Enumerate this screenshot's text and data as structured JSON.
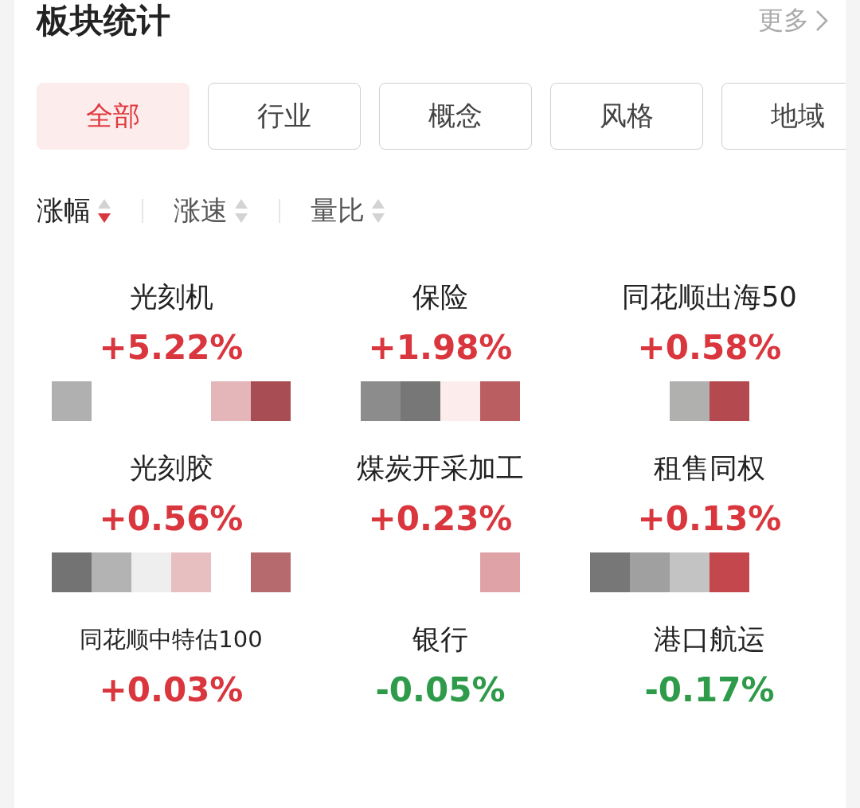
{
  "header": {
    "title": "板块统计",
    "more": "更多"
  },
  "tabs": [
    {
      "label": "全部",
      "selected": true
    },
    {
      "label": "行业",
      "selected": false
    },
    {
      "label": "概念",
      "selected": false
    },
    {
      "label": "风格",
      "selected": false
    },
    {
      "label": "地域",
      "selected": false
    }
  ],
  "sort_options": [
    {
      "label": "涨幅",
      "selected": true
    },
    {
      "label": "涨速",
      "selected": false
    },
    {
      "label": "量比",
      "selected": false
    }
  ],
  "sectors": [
    {
      "name": "光刻机",
      "change": "+5.22%",
      "kind": "up",
      "cells": [
        {
          "color": "#b0b0b0"
        },
        {
          "kind": "blank"
        },
        {
          "kind": "blank"
        },
        {
          "kind": "blank"
        },
        {
          "color": "#e4b5b9"
        },
        {
          "color": "#a84d53"
        }
      ]
    },
    {
      "name": "保险",
      "change": "+1.98%",
      "kind": "up",
      "cells": [
        {
          "kind": "blank"
        },
        {
          "color": "#8c8c8c"
        },
        {
          "color": "#777777"
        },
        {
          "color": "#fcecec"
        },
        {
          "color": "#bb5e62"
        },
        {
          "kind": "blank"
        }
      ]
    },
    {
      "name": "同花顺出海50",
      "change": "+0.58%",
      "kind": "up",
      "cells": [
        {
          "kind": "blank"
        },
        {
          "kind": "blank"
        },
        {
          "color": "#b0b0af"
        },
        {
          "color": "#b44a50"
        },
        {
          "kind": "blank"
        },
        {
          "kind": "blank"
        }
      ]
    },
    {
      "name": "光刻胶",
      "change": "+0.56%",
      "kind": "up",
      "cells": [
        {
          "color": "#737373"
        },
        {
          "color": "#b3b3b3"
        },
        {
          "color": "#eeeeee"
        },
        {
          "color": "#e8bfc1"
        },
        {
          "kind": "blank"
        },
        {
          "color": "#b66a6e"
        }
      ]
    },
    {
      "name": "煤炭开采加工",
      "change": "+0.23%",
      "kind": "up",
      "cells": [
        {
          "kind": "blank"
        },
        {
          "kind": "blank"
        },
        {
          "kind": "blank"
        },
        {
          "kind": "blank"
        },
        {
          "color": "#dfa2a6"
        },
        {
          "kind": "blank"
        }
      ]
    },
    {
      "name": "租售同权",
      "change": "+0.13%",
      "kind": "up",
      "cells": [
        {
          "color": "#777777"
        },
        {
          "color": "#a0a0a0"
        },
        {
          "color": "#c3c3c3"
        },
        {
          "color": "#c4474e"
        },
        {
          "kind": "blank"
        },
        {
          "kind": "blank"
        }
      ]
    },
    {
      "name": "同花顺中特估100",
      "change": "+0.03%",
      "kind": "up"
    },
    {
      "name": "银行",
      "change": "-0.05%",
      "kind": "down"
    },
    {
      "name": "港口航运",
      "change": "-0.17%",
      "kind": "down"
    }
  ]
}
